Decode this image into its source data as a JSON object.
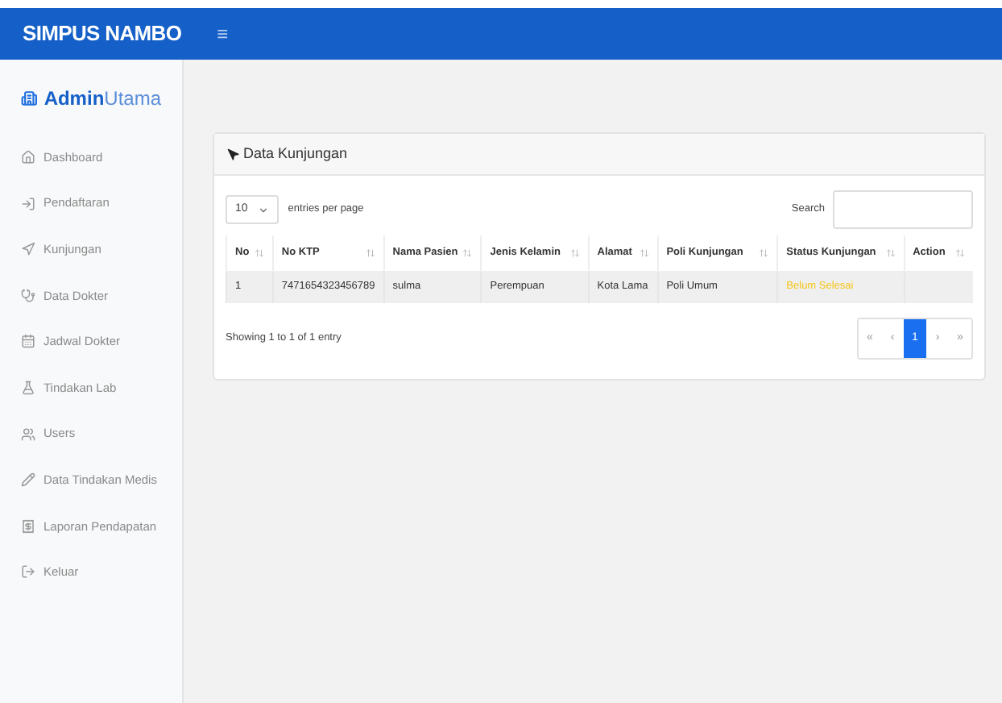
{
  "topbar": {
    "brand": "SIMPUS NAMBO",
    "menu_toggle": "≡"
  },
  "sidebar": {
    "logo_bold": "Admin",
    "logo_light": "Utama",
    "items": [
      {
        "label": "Dashboard"
      },
      {
        "label": "Pendaftaran"
      },
      {
        "label": "Kunjungan"
      },
      {
        "label": "Data Dokter"
      },
      {
        "label": "Jadwal Dokter"
      },
      {
        "label": "Tindakan Lab"
      },
      {
        "label": "Users"
      },
      {
        "label": "Data Tindakan Medis"
      },
      {
        "label": "Laporan Pendapatan"
      },
      {
        "label": "Keluar"
      }
    ]
  },
  "card": {
    "title": "Data Kunjungan",
    "page_size": "10",
    "entries_label": "entries per page",
    "search_label": "Search",
    "table": {
      "columns": [
        "No",
        "No KTP",
        "Nama Pasien",
        "Jenis Kelamin",
        "Alamat",
        "Poli Kunjungan",
        "Status Kunjungan",
        "Action"
      ],
      "rows": [
        {
          "cells": [
            "1",
            "7471654323456789",
            "sulma",
            "Perempuan",
            "Kota Lama",
            "Poli Umum",
            "Belum Selesai"
          ],
          "color": "#f5c518"
        }
      ]
    },
    "info": "Showing 1 to 1 of 1 entry",
    "pagination": [
      {
        "label": "«",
        "selected": false
      },
      {
        "label": "‹",
        "selected": false
      },
      {
        "label": "1",
        "selected": true
      },
      {
        "label": "›",
        "selected": false
      },
      {
        "label": "»",
        "selected": false
      }
    ]
  }
}
